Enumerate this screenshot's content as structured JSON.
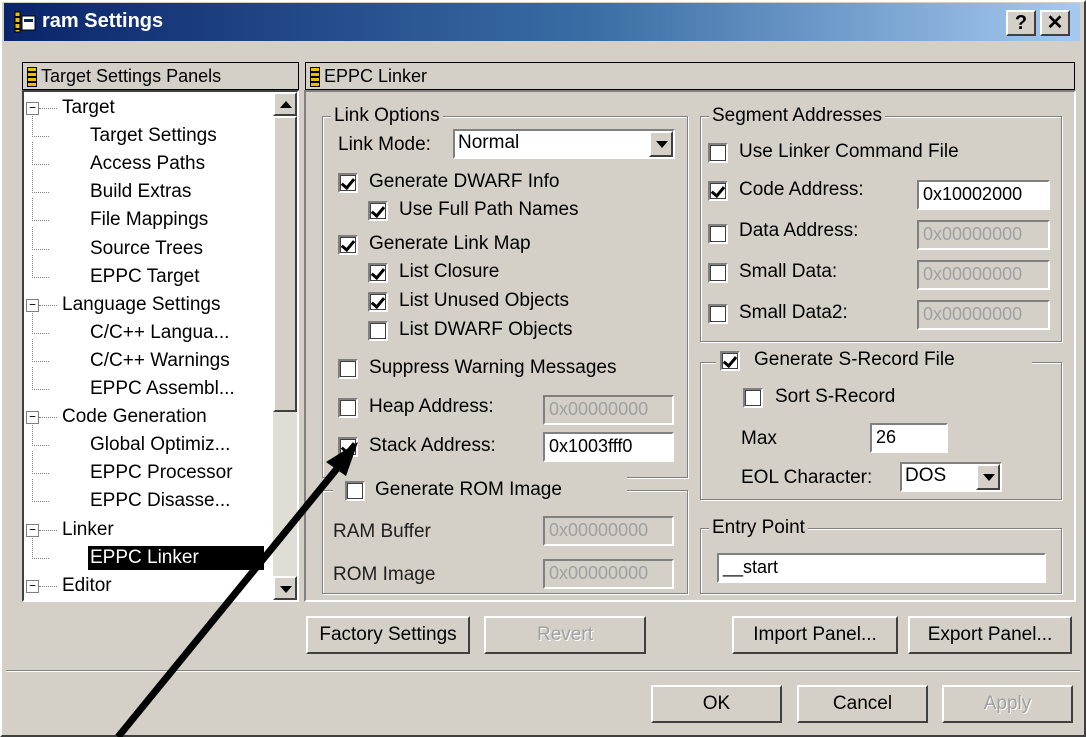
{
  "window": {
    "title": "ram Settings",
    "help_label": "?",
    "close_label": "✕"
  },
  "left_panel": {
    "header": "Target Settings Panels",
    "tree": [
      {
        "label": "Target",
        "level": 0,
        "expander": "−"
      },
      {
        "label": "Target Settings",
        "level": 1
      },
      {
        "label": "Access Paths",
        "level": 1
      },
      {
        "label": "Build Extras",
        "level": 1
      },
      {
        "label": "File Mappings",
        "level": 1
      },
      {
        "label": "Source Trees",
        "level": 1
      },
      {
        "label": "EPPC Target",
        "level": 1
      },
      {
        "label": "Language Settings",
        "level": 0,
        "expander": "−"
      },
      {
        "label": "C/C++ Langua...",
        "level": 1
      },
      {
        "label": "C/C++ Warnings",
        "level": 1
      },
      {
        "label": "EPPC Assembl...",
        "level": 1
      },
      {
        "label": "Code Generation",
        "level": 0,
        "expander": "−"
      },
      {
        "label": "Global Optimiz...",
        "level": 1
      },
      {
        "label": "EPPC Processor",
        "level": 1
      },
      {
        "label": "EPPC Disasse...",
        "level": 1
      },
      {
        "label": "Linker",
        "level": 0,
        "expander": "−"
      },
      {
        "label": "EPPC Linker",
        "level": 1,
        "selected": true
      },
      {
        "label": "Editor",
        "level": 0,
        "expander": "−"
      }
    ]
  },
  "right_panel": {
    "header": "EPPC Linker",
    "link_options": {
      "title": "Link Options",
      "link_mode_label": "Link Mode:",
      "link_mode_value": "Normal",
      "generate_dwarf": "Generate DWARF Info",
      "use_full_path": "Use Full Path Names",
      "generate_link_map": "Generate Link Map",
      "list_closure": "List Closure",
      "list_unused": "List Unused Objects",
      "list_dwarf": "List DWARF Objects",
      "suppress_warnings": "Suppress Warning Messages",
      "heap_address_label": "Heap Address:",
      "heap_address_value": "0x00000000",
      "stack_address_label": "Stack Address:",
      "stack_address_value": "0x1003fff0"
    },
    "rom_image": {
      "title": "Generate ROM Image",
      "ram_buffer_label": "RAM Buffer",
      "ram_buffer_value": "0x00000000",
      "rom_image_label": "ROM Image",
      "rom_image_value": "0x00000000"
    },
    "segment_addresses": {
      "title": "Segment Addresses",
      "use_linker_cmd": "Use Linker Command File",
      "code_address_label": "Code Address:",
      "code_address_value": "0x10002000",
      "data_address_label": "Data Address:",
      "data_address_value": "0x00000000",
      "small_data_label": "Small Data:",
      "small_data_value": "0x00000000",
      "small_data2_label": "Small Data2:",
      "small_data2_value": "0x00000000"
    },
    "srecord": {
      "title": "Generate S-Record File",
      "sort_label": "Sort S-Record",
      "max_label": "Max",
      "max_value": "26",
      "eol_label": "EOL Character:",
      "eol_value": "DOS"
    },
    "entry_point": {
      "title": "Entry Point",
      "value": "__start"
    }
  },
  "buttons": {
    "factory": "Factory Settings",
    "revert": "Revert",
    "import": "Import Panel...",
    "export": "Export Panel...",
    "ok": "OK",
    "cancel": "Cancel",
    "apply": "Apply"
  }
}
